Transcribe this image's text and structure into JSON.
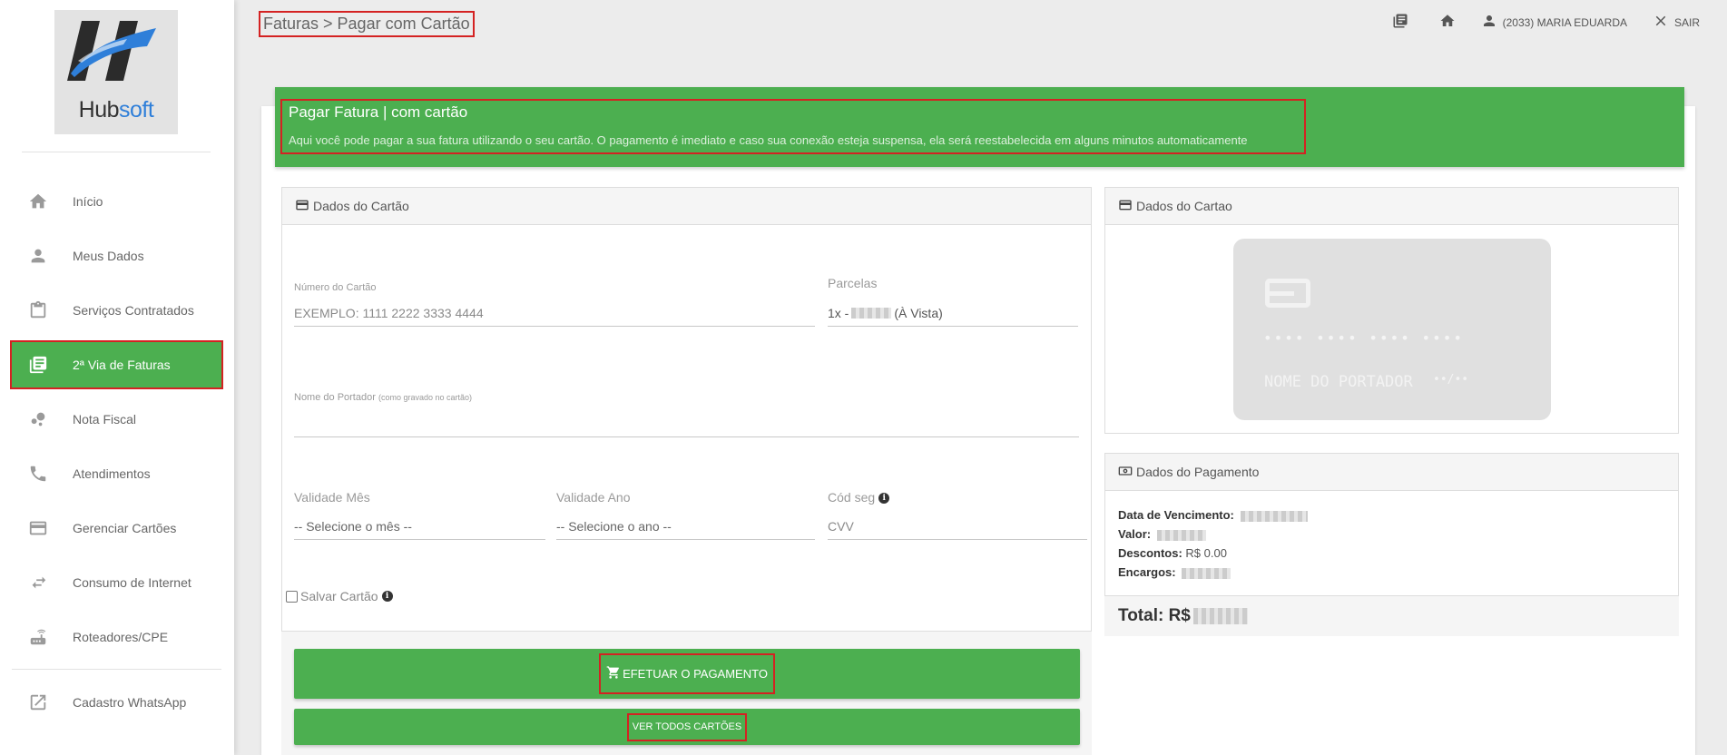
{
  "sidebar": {
    "logo": {
      "hub": "Hub",
      "soft": "soft"
    },
    "items": [
      {
        "label": "Início",
        "icon": "home-icon"
      },
      {
        "label": "Meus Dados",
        "icon": "person-icon"
      },
      {
        "label": "Serviços Contratados",
        "icon": "clipboard-icon"
      },
      {
        "label": "2ª Via de Faturas",
        "icon": "invoices-icon",
        "active": true
      },
      {
        "label": "Nota Fiscal",
        "icon": "bubbles-icon"
      },
      {
        "label": "Atendimentos",
        "icon": "phone-icon"
      },
      {
        "label": "Gerenciar Cartões",
        "icon": "credit-card-icon"
      },
      {
        "label": "Consumo de Internet",
        "icon": "transfer-icon"
      },
      {
        "label": "Roteadores/CPE",
        "icon": "router-icon"
      },
      {
        "label": "Cadastro WhatsApp",
        "icon": "external-link-icon"
      }
    ]
  },
  "header": {
    "breadcrumb": "Faturas > Pagar com Cartão",
    "user_label": "(2033) MARIA EDUARDA",
    "logout_label": "SAIR"
  },
  "banner": {
    "title": "Pagar Fatura | com cartão",
    "description": "Aqui você pode pagar a sua fatura utilizando o seu cartão. O pagamento é imediato e caso sua conexão esteja suspensa, ela será reestabelecida em alguns minutos automaticamente"
  },
  "card_form": {
    "heading": "Dados do Cartão",
    "card_number_label": "Número do Cartão",
    "card_number_placeholder": "EXEMPLO: 1111 2222 3333 4444",
    "installments_label": "Parcelas",
    "installments_prefix": "1x -",
    "installments_suffix": "(À Vista)",
    "holder_label": "Nome do Portador",
    "holder_hint": "(como gravado no cartão)",
    "month_label": "Validade Mês",
    "month_value": "-- Selecione o mês --",
    "year_label": "Validade Ano",
    "year_value": "-- Selecione o ano --",
    "cvv_label": "Cód seg",
    "cvv_placeholder": "CVV",
    "save_label": "Salvar Cartão",
    "pay_button": "EFETUAR O PAGAMENTO",
    "all_cards_button": "VER TODOS CARTÕES"
  },
  "card_preview": {
    "heading": "Dados do Cartao",
    "number_mask": "•••• •••• •••• ••••",
    "holder": "NOME DO PORTADOR",
    "expiry": "••/••"
  },
  "payment": {
    "heading": "Dados do Pagamento",
    "due_label": "Data de Vencimento:",
    "value_label": "Valor:",
    "discount_label": "Descontos:",
    "discount_value": "R$ 0.00",
    "charges_label": "Encargos:",
    "total_label": "Total: R$"
  },
  "colors": {
    "accent_green": "#4caf50",
    "highlight_red": "#d42222",
    "logo_blue": "#2f7fd9"
  }
}
